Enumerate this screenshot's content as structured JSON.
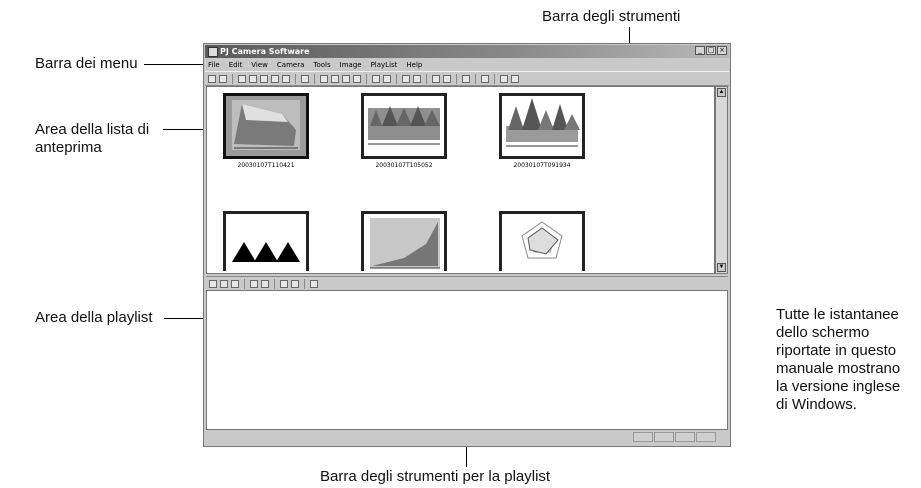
{
  "labels": {
    "toolbar": "Barra degli strumenti",
    "menubar": "Barra dei menu",
    "preview_line1": "Area della lista di",
    "preview_line2": "anteprima",
    "playlist_area": "Area della playlist",
    "playlist_toolbar": "Barra degli strumenti per la playlist",
    "note": [
      "Tutte le istantanee",
      "dello schermo",
      "riportate in questo",
      "manuale mostrano",
      "la versione inglese",
      "di Windows."
    ]
  },
  "window": {
    "title": "PJ Camera Software",
    "controls": [
      "_",
      "□",
      "×"
    ],
    "menu": [
      "File",
      "Edit",
      "View",
      "Camera",
      "Tools",
      "Image",
      "PlayList",
      "Help"
    ]
  },
  "thumbnails": [
    {
      "caption": "20030107T110421",
      "selected": true,
      "icon": "3d-area-chart-icon"
    },
    {
      "caption": "20030107T105052",
      "selected": false,
      "icon": "3d-cone-chart-icon"
    },
    {
      "caption": "20030107T091934",
      "selected": false,
      "icon": "3d-cone-chart-icon"
    },
    {
      "caption": "",
      "selected": false,
      "icon": "triangles-icon"
    },
    {
      "caption": "",
      "selected": false,
      "icon": "area-chart-icon"
    },
    {
      "caption": "",
      "selected": false,
      "icon": "radar-chart-icon"
    }
  ]
}
